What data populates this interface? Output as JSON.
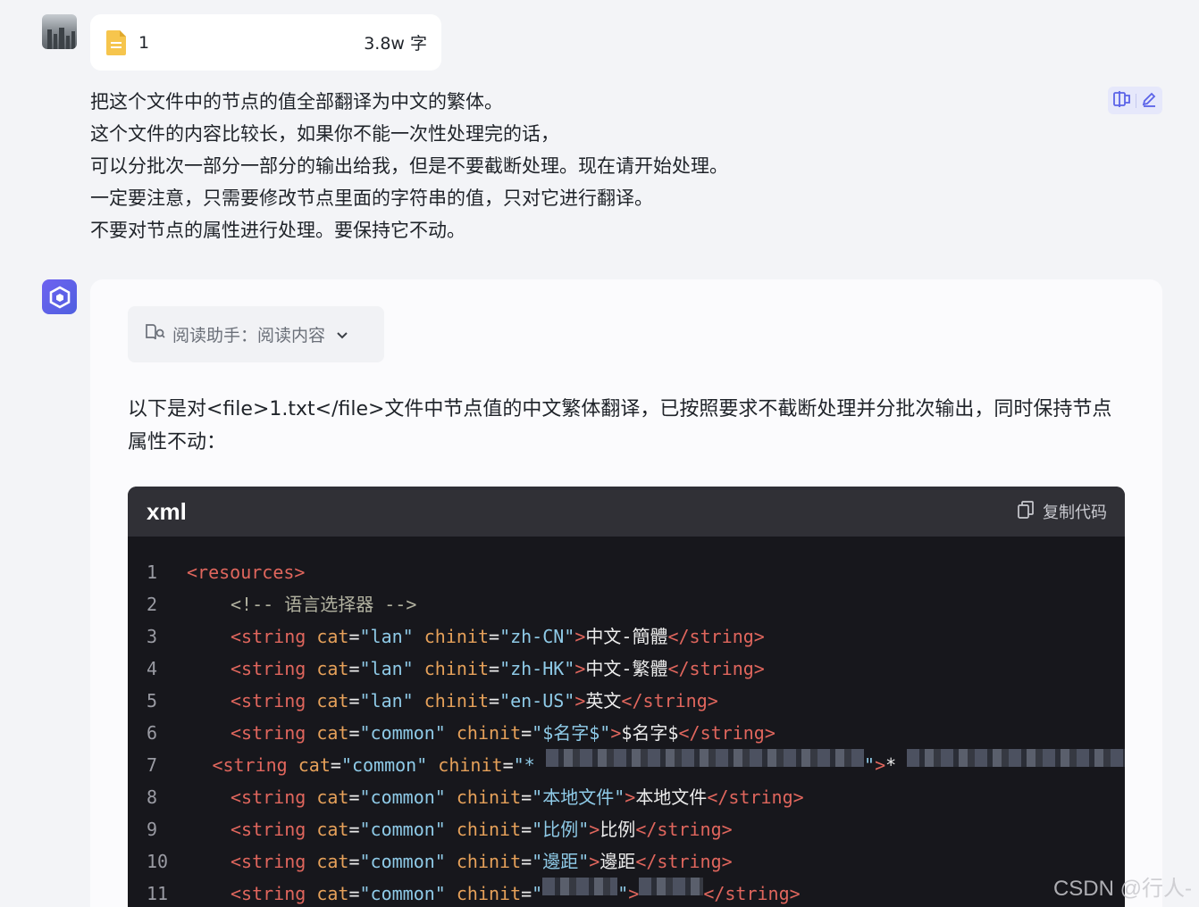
{
  "user_message": {
    "file": {
      "name": "1",
      "size": "3.8w 字"
    },
    "lines": [
      "把这个文件中的节点的值全部翻译为中文的繁体。",
      "这个文件的内容比较长，如果你不能一次性处理完的话，",
      "可以分批次一部分一部分的输出给我，但是不要截断处理。现在请开始处理。",
      "一定要注意，只需要修改节点里面的字符串的值，只对它进行翻译。",
      "不要对节点的属性进行处理。要保持它不动。"
    ],
    "action_icons": [
      "copy-icon",
      "edit-icon"
    ]
  },
  "bot_message": {
    "reader_label": "阅读助手：阅读内容",
    "intro": "以下是对<file>1.txt</file>文件中节点值的中文繁体翻译，已按照要求不截断处理并分批次输出，同时保持节点属性不动：",
    "code": {
      "lang": "xml",
      "copy_label": "复制代码",
      "lines": [
        {
          "n": "1",
          "indent": 0,
          "tokens": [
            [
              "tag",
              "<resources>"
            ]
          ]
        },
        {
          "n": "2",
          "indent": 1,
          "tokens": [
            [
              "comment",
              "<!-- 语言选择器 -->"
            ]
          ]
        },
        {
          "n": "3",
          "indent": 1,
          "tokens": [
            [
              "tag",
              "<string "
            ],
            [
              "attr",
              "cat"
            ],
            [
              "eq",
              "="
            ],
            [
              "val",
              "\"lan\""
            ],
            [
              "attr",
              " chinit"
            ],
            [
              "eq",
              "="
            ],
            [
              "val",
              "\"zh-CN\""
            ],
            [
              "tag",
              ">"
            ],
            [
              "txt",
              "中文-簡體"
            ],
            [
              "tag",
              "</string>"
            ]
          ]
        },
        {
          "n": "4",
          "indent": 1,
          "tokens": [
            [
              "tag",
              "<string "
            ],
            [
              "attr",
              "cat"
            ],
            [
              "eq",
              "="
            ],
            [
              "val",
              "\"lan\""
            ],
            [
              "attr",
              " chinit"
            ],
            [
              "eq",
              "="
            ],
            [
              "val",
              "\"zh-HK\""
            ],
            [
              "tag",
              ">"
            ],
            [
              "txt",
              "中文-繁體"
            ],
            [
              "tag",
              "</string>"
            ]
          ]
        },
        {
          "n": "5",
          "indent": 1,
          "tokens": [
            [
              "tag",
              "<string "
            ],
            [
              "attr",
              "cat"
            ],
            [
              "eq",
              "="
            ],
            [
              "val",
              "\"lan\""
            ],
            [
              "attr",
              " chinit"
            ],
            [
              "eq",
              "="
            ],
            [
              "val",
              "\"en-US\""
            ],
            [
              "tag",
              ">"
            ],
            [
              "txt",
              "英文"
            ],
            [
              "tag",
              "</string>"
            ]
          ]
        },
        {
          "n": "6",
          "indent": 1,
          "tokens": [
            [
              "tag",
              "<string "
            ],
            [
              "attr",
              "cat"
            ],
            [
              "eq",
              "="
            ],
            [
              "val",
              "\"common\""
            ],
            [
              "attr",
              " chinit"
            ],
            [
              "eq",
              "="
            ],
            [
              "val",
              "\"$名字$\""
            ],
            [
              "tag",
              ">"
            ],
            [
              "txt",
              "$名字$"
            ],
            [
              "tag",
              "</string>"
            ]
          ]
        },
        {
          "n": "7",
          "indent": 1,
          "tokens": [
            [
              "tag",
              "<string "
            ],
            [
              "attr",
              "cat"
            ],
            [
              "eq",
              "="
            ],
            [
              "val",
              "\"common\""
            ],
            [
              "attr",
              " chinit"
            ],
            [
              "eq",
              "="
            ],
            [
              "val",
              "\"* "
            ],
            [
              "blur",
              "xxxxxxxxxxxxxxxxxxxxxxxxxxxxxxxxxxxxxx"
            ],
            [
              "val",
              "\""
            ],
            [
              "tag",
              ">"
            ],
            [
              "txt",
              "* "
            ],
            [
              "blur",
              "xxxxxxxxxxxxxxxxxxxxxxxxxx"
            ]
          ]
        },
        {
          "n": "8",
          "indent": 1,
          "tokens": [
            [
              "tag",
              "<string "
            ],
            [
              "attr",
              "cat"
            ],
            [
              "eq",
              "="
            ],
            [
              "val",
              "\"common\""
            ],
            [
              "attr",
              " chinit"
            ],
            [
              "eq",
              "="
            ],
            [
              "val",
              "\"本地文件\""
            ],
            [
              "tag",
              ">"
            ],
            [
              "txt",
              "本地文件"
            ],
            [
              "tag",
              "</string>"
            ]
          ]
        },
        {
          "n": "9",
          "indent": 1,
          "tokens": [
            [
              "tag",
              "<string "
            ],
            [
              "attr",
              "cat"
            ],
            [
              "eq",
              "="
            ],
            [
              "val",
              "\"common\""
            ],
            [
              "attr",
              " chinit"
            ],
            [
              "eq",
              "="
            ],
            [
              "val",
              "\"比例\""
            ],
            [
              "tag",
              ">"
            ],
            [
              "txt",
              "比例"
            ],
            [
              "tag",
              "</string>"
            ]
          ]
        },
        {
          "n": "10",
          "indent": 1,
          "tokens": [
            [
              "tag",
              "<string "
            ],
            [
              "attr",
              "cat"
            ],
            [
              "eq",
              "="
            ],
            [
              "val",
              "\"common\""
            ],
            [
              "attr",
              " chinit"
            ],
            [
              "eq",
              "="
            ],
            [
              "val",
              "\"邊距\""
            ],
            [
              "tag",
              ">"
            ],
            [
              "txt",
              "邊距"
            ],
            [
              "tag",
              "</string>"
            ]
          ]
        },
        {
          "n": "11",
          "indent": 1,
          "tokens": [
            [
              "tag",
              "<string "
            ],
            [
              "attr",
              "cat"
            ],
            [
              "eq",
              "="
            ],
            [
              "val",
              "\"common\""
            ],
            [
              "attr",
              " chinit"
            ],
            [
              "eq",
              "="
            ],
            [
              "val",
              "\""
            ],
            [
              "blur",
              "xxxxxxx"
            ],
            [
              "val",
              "\""
            ],
            [
              "tag",
              ">"
            ],
            [
              "blur",
              "xxxxxx"
            ],
            [
              "tag",
              "</string>"
            ]
          ]
        }
      ]
    }
  },
  "watermark": "CSDN @行人-",
  "colors": {
    "tag": "#e0665d",
    "attr": "#e6a15a",
    "value": "#8fcbe8",
    "accent": "#5b63e8"
  }
}
